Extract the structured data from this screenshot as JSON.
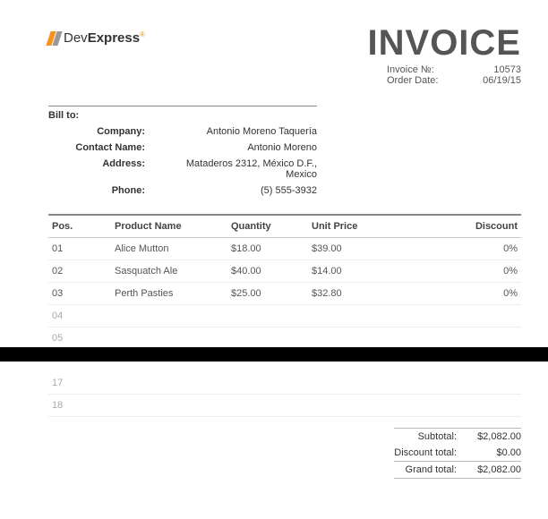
{
  "brand": {
    "name_a": "Dev",
    "name_b": "Express",
    "reg": "®"
  },
  "invoice": {
    "title": "INVOICE",
    "meta": {
      "number_label": "Invoice №:",
      "number": "10573",
      "date_label": "Order Date:",
      "date": "06/19/15"
    }
  },
  "bill_to": {
    "heading": "Bill to:",
    "rows": [
      {
        "label": "Company:",
        "value": "Antonio Moreno Taquería"
      },
      {
        "label": "Contact Name:",
        "value": "Antonio Moreno"
      },
      {
        "label": "Address:",
        "value": "Mataderos  2312, México D.F., Mexico"
      },
      {
        "label": "Phone:",
        "value": "(5) 555-3932"
      }
    ]
  },
  "table": {
    "headers": {
      "pos": "Pos.",
      "product": "Product Name",
      "qty": "Quantity",
      "unit": "Unit Price",
      "disc": "Discount"
    },
    "rows": [
      {
        "pos": "01",
        "product": "Alice Mutton",
        "qty": "$18.00",
        "unit": "$39.00",
        "disc": "0%"
      },
      {
        "pos": "02",
        "product": "Sasquatch Ale",
        "qty": "$40.00",
        "unit": "$14.00",
        "disc": "0%"
      },
      {
        "pos": "03",
        "product": "Perth Pasties",
        "qty": "$25.00",
        "unit": "$32.80",
        "disc": "0%"
      }
    ],
    "empty_page1": [
      "04",
      "05"
    ],
    "empty_page2": [
      "17",
      "18"
    ]
  },
  "totals": {
    "subtotal_label": "Subtotal:",
    "subtotal": "$2,082.00",
    "discount_label": "Discount total:",
    "discount": "$0.00",
    "grand_label": "Grand total:",
    "grand": "$2,082.00"
  }
}
